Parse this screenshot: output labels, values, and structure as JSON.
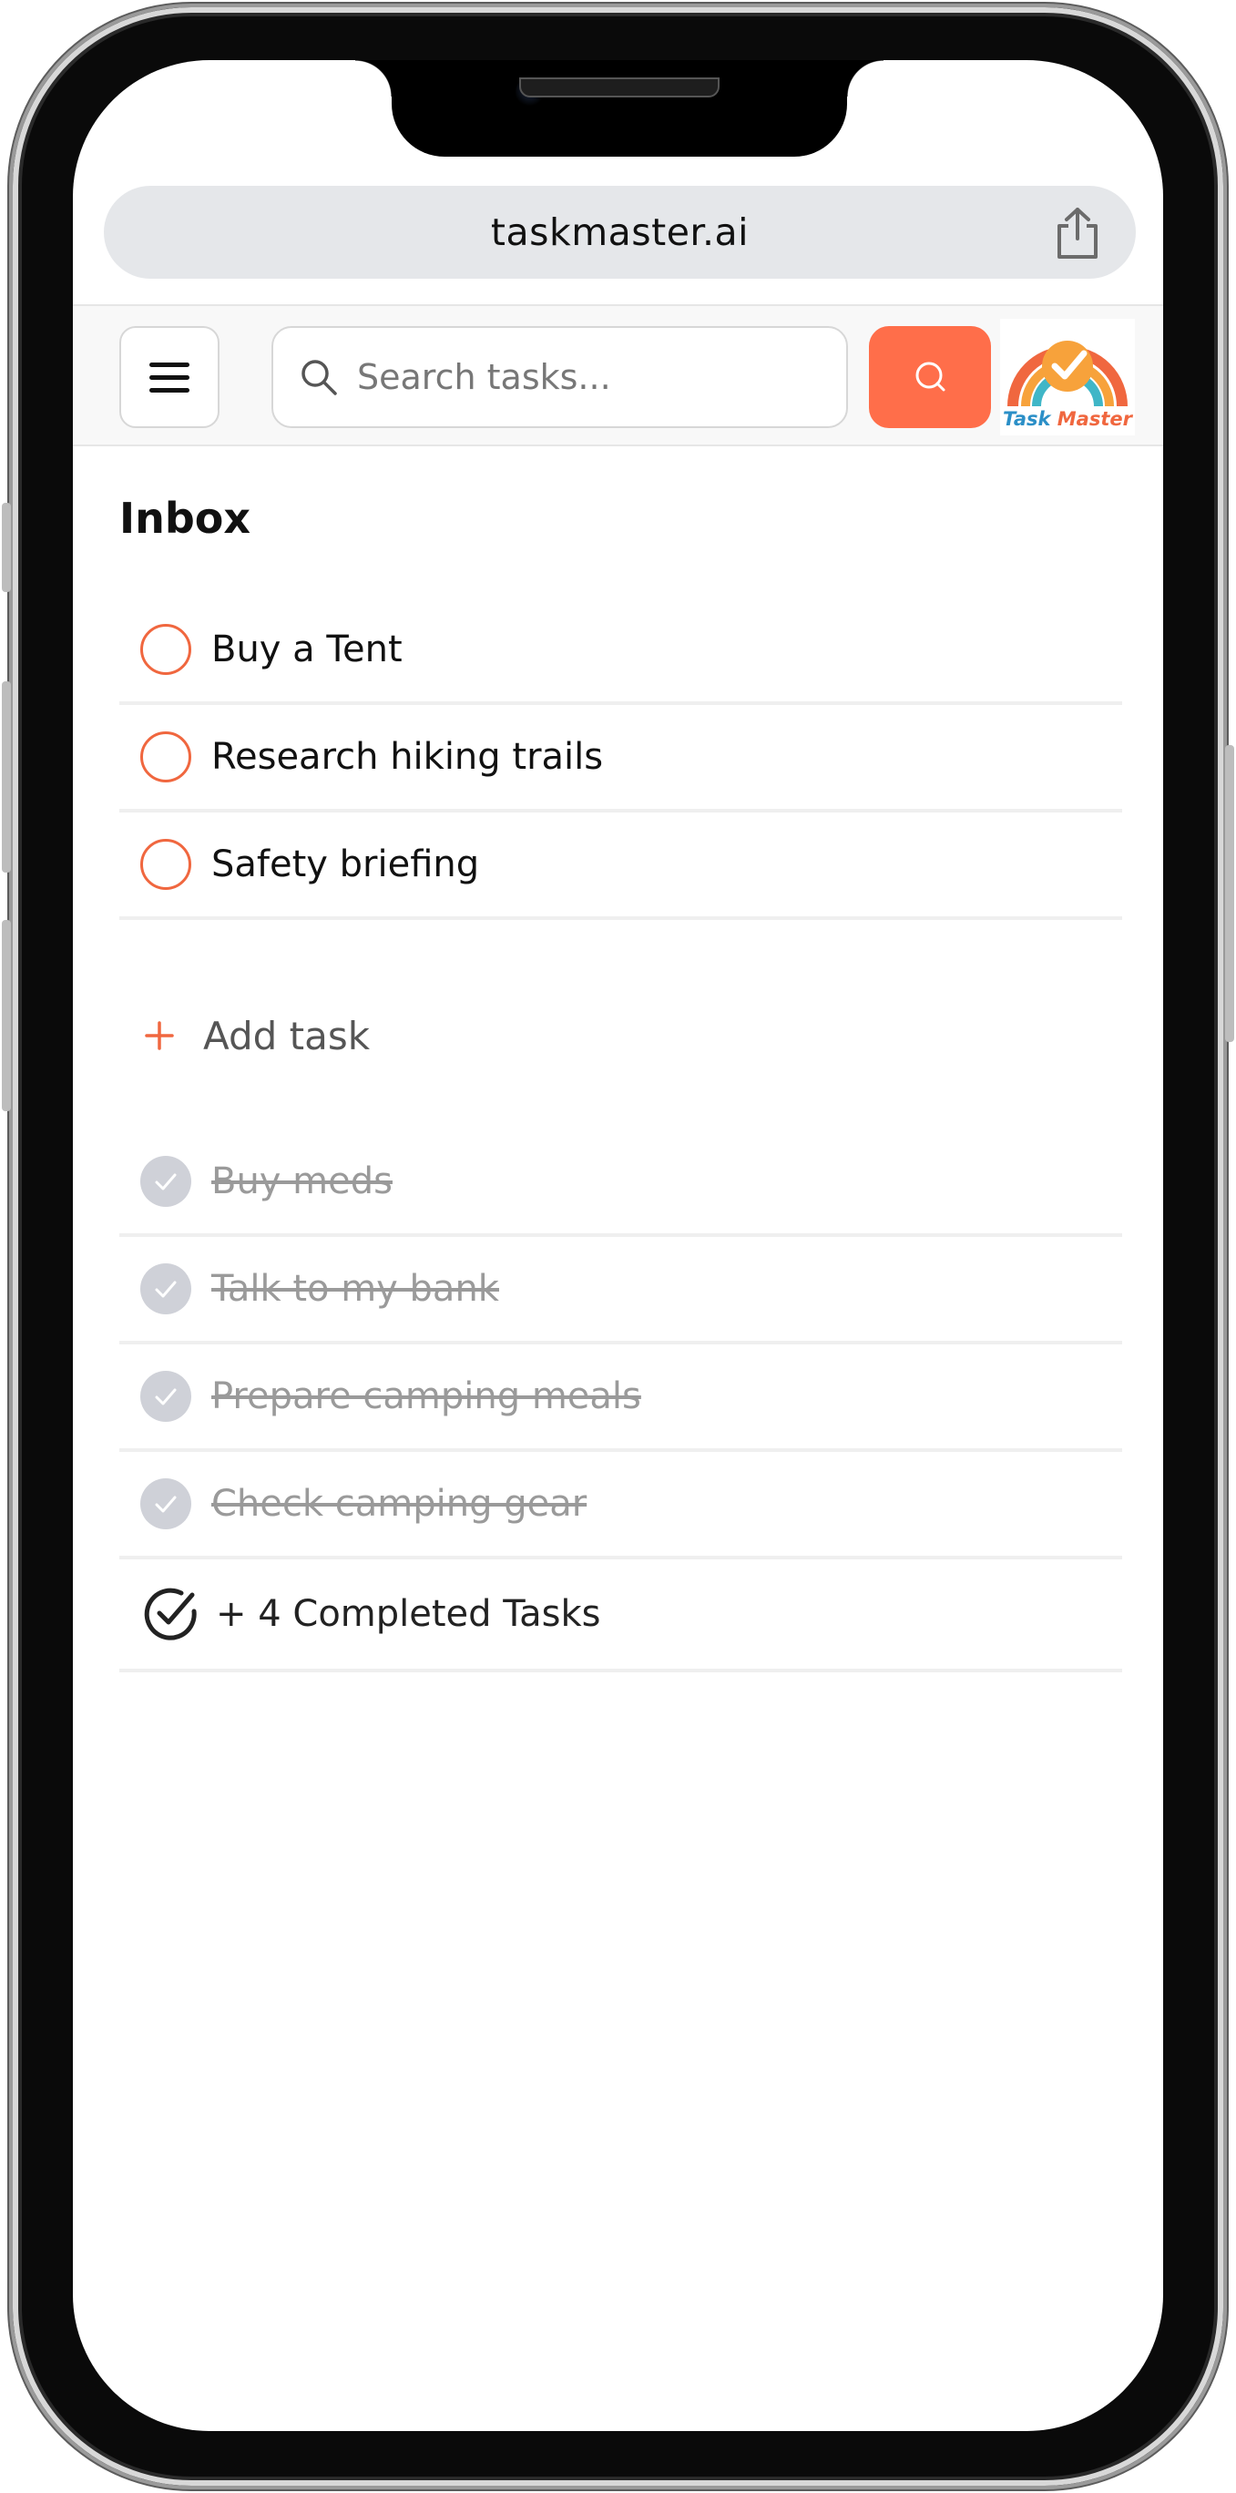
{
  "browser": {
    "url": "taskmaster.ai"
  },
  "header": {
    "search_placeholder": "Search tasks...",
    "logo_text": "Task Master",
    "accent_color": "#ff6e4a"
  },
  "inbox": {
    "title": "Inbox",
    "tasks": [
      {
        "label": "Buy a Tent",
        "done": false
      },
      {
        "label": "Research hiking trails",
        "done": false
      },
      {
        "label": "Safety briefing",
        "done": false
      }
    ],
    "add_task_label": "Add task",
    "completed": [
      {
        "label": "Buy meds",
        "done": true
      },
      {
        "label": "Talk to my bank",
        "done": true
      },
      {
        "label": "Prepare camping meals",
        "done": true
      },
      {
        "label": "Check camping gear",
        "done": true
      }
    ],
    "completed_summary": "+ 4 Completed Tasks"
  }
}
